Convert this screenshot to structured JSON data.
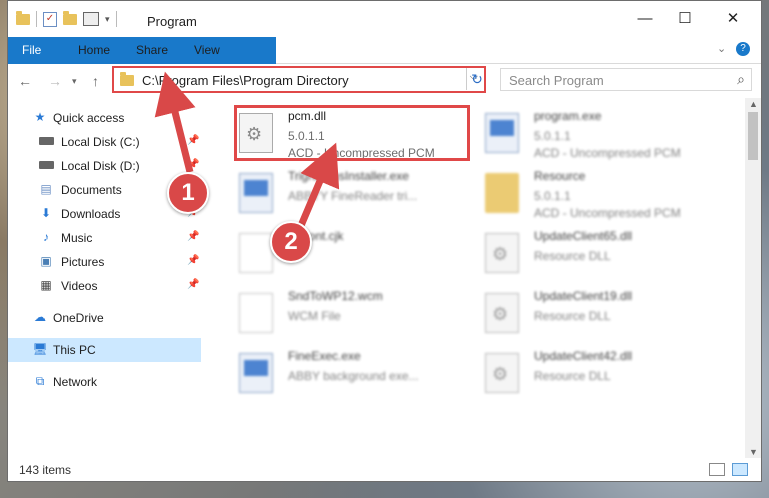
{
  "window": {
    "title": "Program"
  },
  "ribbon": {
    "tabs": [
      "File",
      "Home",
      "Share",
      "View"
    ]
  },
  "address": {
    "path": "C:\\Program Files\\Program Directory",
    "search_placeholder": "Search Program"
  },
  "sidebar": {
    "items": [
      {
        "label": "Quick access",
        "icon": "star-icon",
        "pinned": false
      },
      {
        "label": "Local Disk (C:)",
        "icon": "drive-icon",
        "pinned": true
      },
      {
        "label": "Local Disk (D:)",
        "icon": "drive-icon",
        "pinned": true
      },
      {
        "label": "Documents",
        "icon": "documents-icon",
        "pinned": true
      },
      {
        "label": "Downloads",
        "icon": "download-icon",
        "pinned": true
      },
      {
        "label": "Music",
        "icon": "music-icon",
        "pinned": true
      },
      {
        "label": "Pictures",
        "icon": "pictures-icon",
        "pinned": true
      },
      {
        "label": "Videos",
        "icon": "videos-icon",
        "pinned": true
      },
      {
        "label": "OneDrive",
        "icon": "cloud-icon",
        "pinned": false
      },
      {
        "label": "This PC",
        "icon": "computer-icon",
        "pinned": false,
        "selected": true
      },
      {
        "label": "Network",
        "icon": "network-icon",
        "pinned": false
      }
    ]
  },
  "files": [
    {
      "name": "pcm.dll",
      "line2": "5.0.1.1",
      "line3": "ACD - Uncompressed PCM",
      "icon": "dll-gear-icon",
      "highlighted": true
    },
    {
      "name": "program.exe",
      "line2": "5.0.1.1",
      "line3": "ACD - Uncompressed PCM",
      "icon": "exe-icon"
    },
    {
      "name": "TrigrammsInstaller.exe",
      "line2": "ABBYY FineReader tri...",
      "line3": "",
      "icon": "exe-icon"
    },
    {
      "name": "Resource",
      "line2": "5.0.1.1",
      "line3": "ACD - Uncompressed PCM",
      "icon": "folder-icon"
    },
    {
      "name": "...tFont.cjk",
      "line2": "...",
      "line3": "",
      "icon": "document-icon"
    },
    {
      "name": "UpdateClient65.dll",
      "line2": "Resource DLL",
      "line3": "",
      "icon": "dll-gear-icon"
    },
    {
      "name": "SndToWP12.wcm",
      "line2": "WCM File",
      "line3": "",
      "icon": "document-icon"
    },
    {
      "name": "UpdateClient19.dll",
      "line2": "Resource DLL",
      "line3": "",
      "icon": "dll-gear-icon"
    },
    {
      "name": "FineExec.exe",
      "line2": "ABBY background exe...",
      "line3": "",
      "icon": "exe-icon"
    },
    {
      "name": "UpdateClient42.dll",
      "line2": "Resource DLL",
      "line3": "",
      "icon": "dll-gear-icon"
    }
  ],
  "status": {
    "count": "143 items"
  },
  "callouts": [
    "1",
    "2"
  ],
  "colors": {
    "accent": "#1979ca",
    "highlight": "#e04848",
    "selected": "#cce8ff"
  }
}
